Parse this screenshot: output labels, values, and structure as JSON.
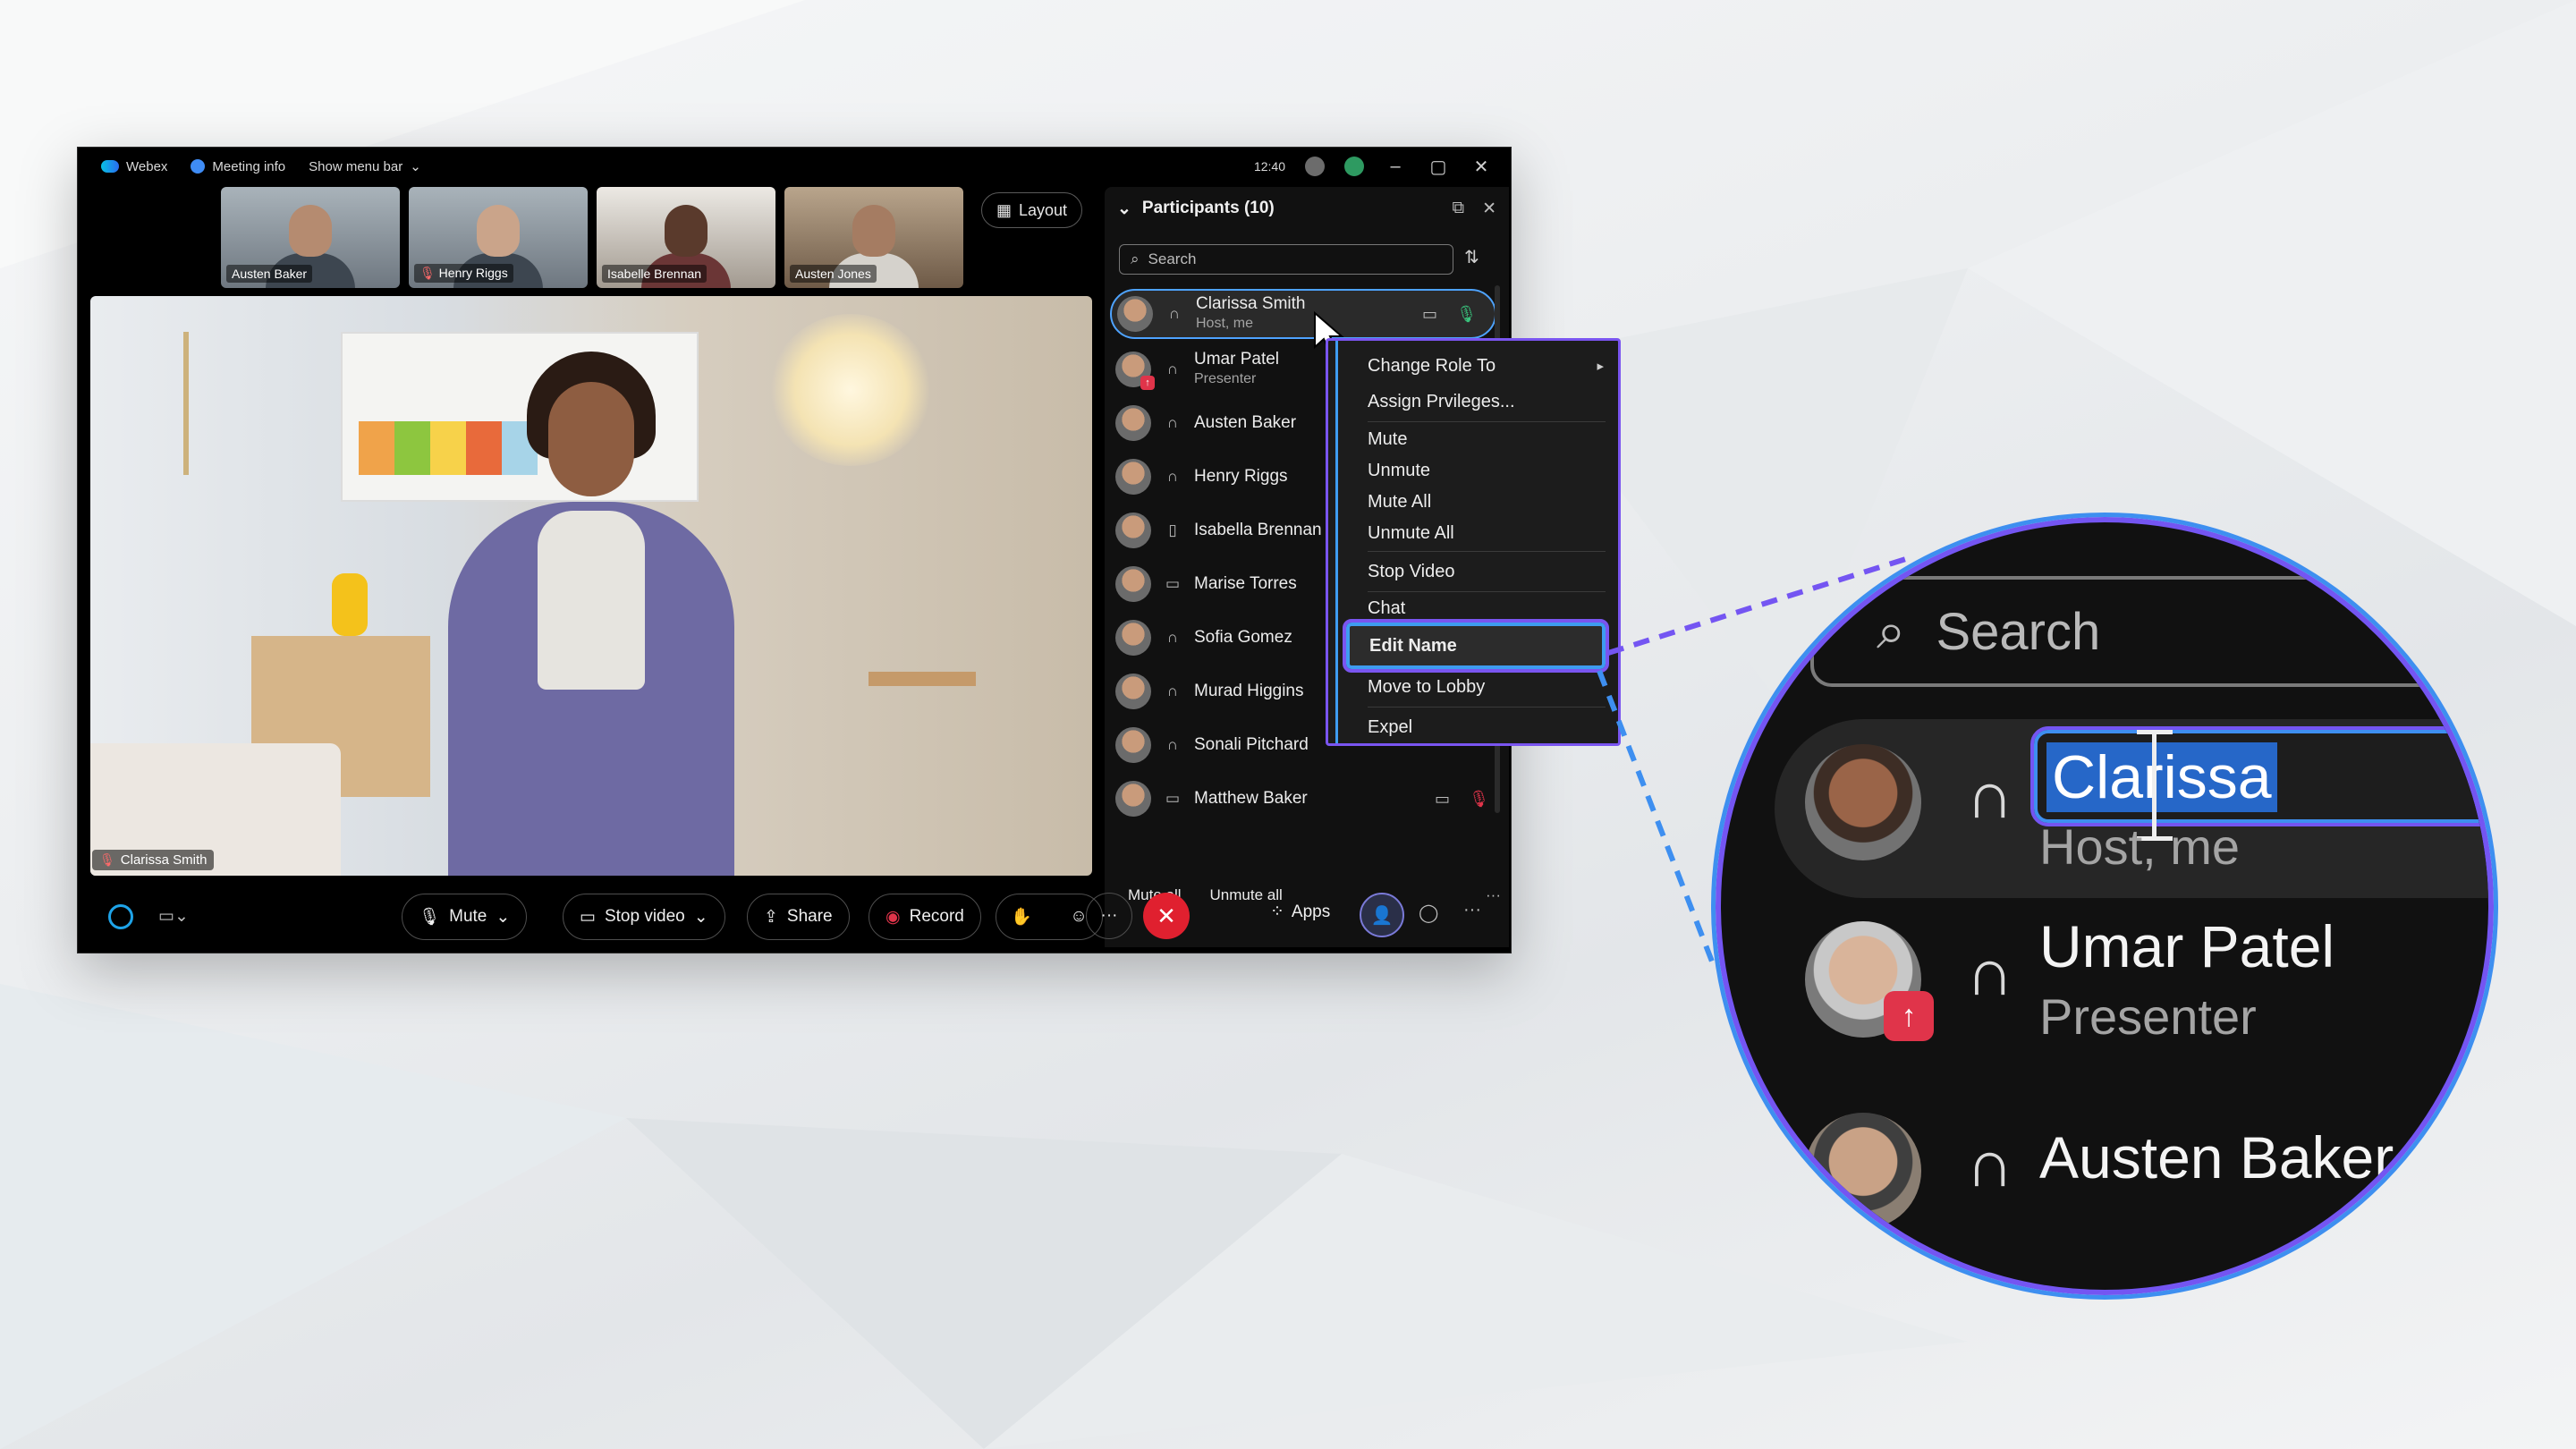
{
  "window": {
    "app_name": "Webex",
    "meeting_info": "Meeting info",
    "menu_bar": "Show menu bar",
    "time": "12:40"
  },
  "thumbnails": [
    {
      "name": "Austen Baker"
    },
    {
      "name": "Henry Riggs"
    },
    {
      "name": "Isabelle Brennan"
    },
    {
      "name": "Austen Jones"
    }
  ],
  "layout_button": "Layout",
  "stage": {
    "speaker": "Clarissa Smith"
  },
  "participants": {
    "title": "Participants (10)",
    "search_placeholder": "Search",
    "list": [
      {
        "name": "Clarissa Smith",
        "role": "Host, me"
      },
      {
        "name": "Umar Patel",
        "role": "Presenter"
      },
      {
        "name": "Austen Baker",
        "role": ""
      },
      {
        "name": "Henry Riggs",
        "role": ""
      },
      {
        "name": "Isabella Brennan",
        "role": ""
      },
      {
        "name": "Marise Torres",
        "role": ""
      },
      {
        "name": "Sofia Gomez",
        "role": ""
      },
      {
        "name": "Murad Higgins",
        "role": ""
      },
      {
        "name": "Sonali Pitchard",
        "role": ""
      },
      {
        "name": "Matthew Baker",
        "role": ""
      }
    ],
    "mute_all": "Mute all",
    "unmute_all": "Unmute all"
  },
  "controls": {
    "mute": "Mute",
    "stop_video": "Stop video",
    "share": "Share",
    "record": "Record",
    "apps": "Apps"
  },
  "context_menu": {
    "change_role": "Change Role To",
    "assign_privileges": "Assign Prvileges...",
    "mute": "Mute",
    "unmute": "Unmute",
    "mute_all": "Mute All",
    "unmute_all": "Unmute All",
    "stop_video": "Stop Video",
    "chat": "Chat",
    "edit_name": "Edit Name",
    "move_to_lobby": "Move to Lobby",
    "expel": "Expel"
  },
  "magnifier": {
    "search": "Search",
    "edit_value": "Clarissa",
    "row1_sub": "Host, me",
    "row2_name": "Umar Patel",
    "row2_sub": "Presenter",
    "row3_name": "Austen Baker"
  },
  "colors": {
    "accent_blue": "#3e8ff0",
    "accent_purple": "#7455f2",
    "end_call_red": "#e0202f",
    "badge_red": "#e0344a"
  }
}
